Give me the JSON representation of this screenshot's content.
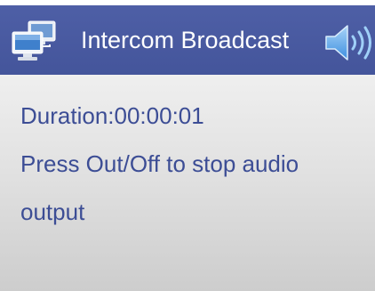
{
  "header": {
    "title": "Intercom Broadcast",
    "left_icon": "computer-network-icon",
    "right_icon": "speaker-volume-icon"
  },
  "status": {
    "duration_label": "Duration:",
    "duration_value": "00:00:01",
    "instruction_line1": "Press Out/Off to stop audio",
    "instruction_line2": "output"
  },
  "colors": {
    "header_bg": "#4a5ba2",
    "text_primary": "#3c4d95",
    "header_text": "#ffffff"
  }
}
